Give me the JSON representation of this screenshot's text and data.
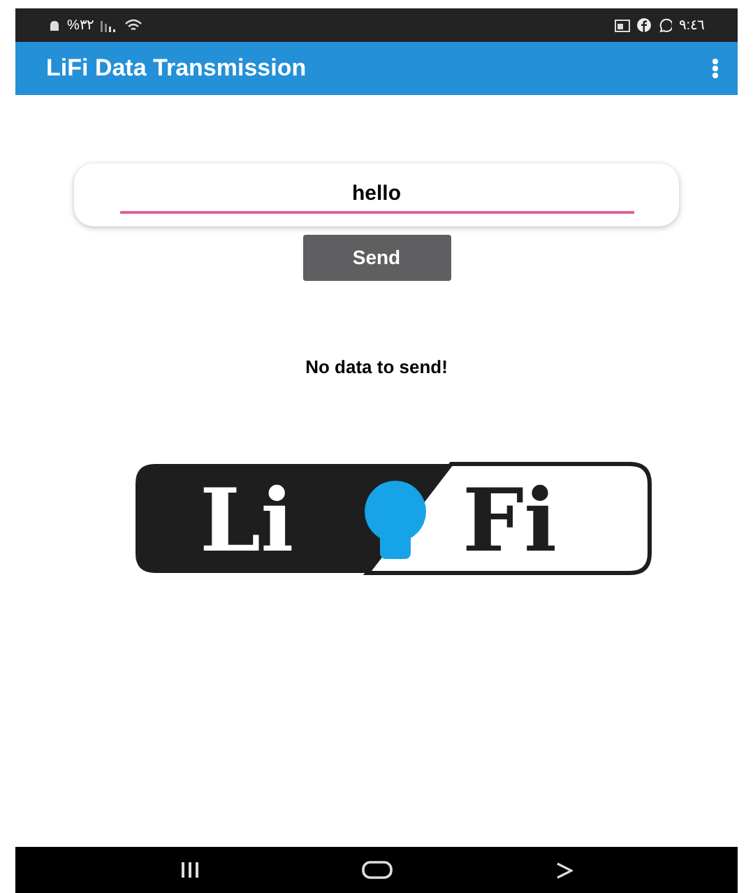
{
  "status_bar": {
    "battery": "%٣٢",
    "time": "٩:٤٦"
  },
  "app_bar": {
    "title": "LiFi Data Transmission"
  },
  "message_field": {
    "value": "hello"
  },
  "send_button": {
    "label": "Send"
  },
  "status_message": "No data to send!",
  "logo": {
    "left_text": "Li",
    "right_text": "Fi"
  }
}
